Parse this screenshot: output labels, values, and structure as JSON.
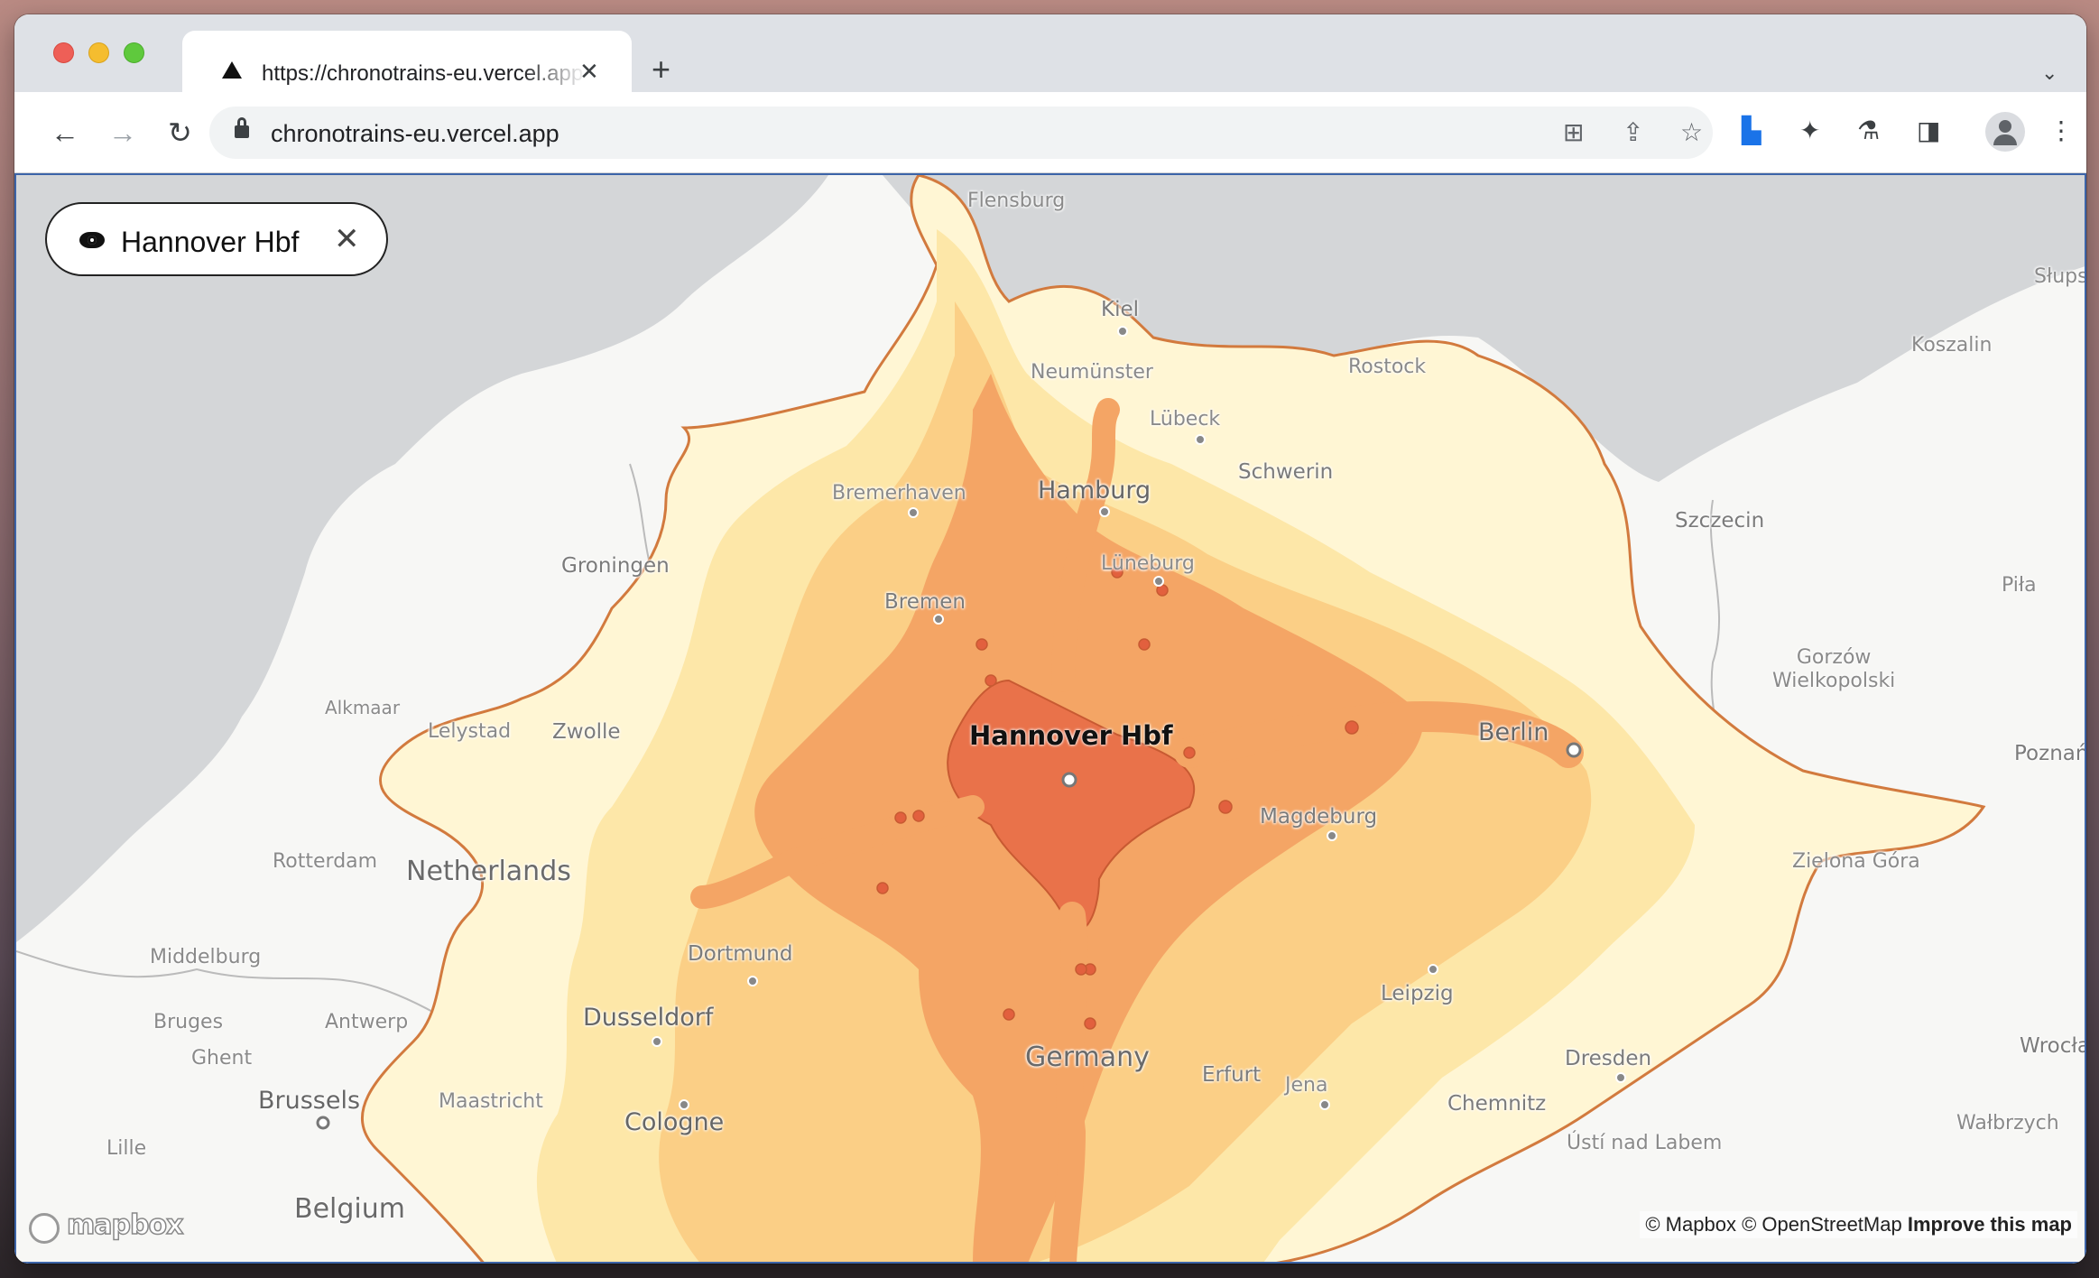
{
  "browser": {
    "tab_title": "https://chronotrains-eu.vercel.app",
    "tab_close": "✕",
    "new_tab": "+",
    "tab_menu": "⌄",
    "url": "chronotrains-eu.vercel.app",
    "icons": [
      "back-icon",
      "forward-icon",
      "reload-icon",
      "lock-icon",
      "translate-icon",
      "share-icon",
      "star-icon",
      "analytics-extension-icon",
      "extensions-icon",
      "labs-icon",
      "side-panel-icon",
      "profile-icon",
      "menu-icon"
    ]
  },
  "search": {
    "station": "Hannover Hbf",
    "close": "✕"
  },
  "map": {
    "labels": {
      "flensburg": "Flensburg",
      "kiel": "Kiel",
      "neumunster": "Neumünster",
      "lubeck": "Lübeck",
      "rostock": "Rostock",
      "hamburg": "Hamburg",
      "schwerin": "Schwerin",
      "bremerhaven": "Bremerhaven",
      "luneburg": "Lüneburg",
      "groningen": "Groningen",
      "bremen": "Bremen",
      "szczecin": "Szczecin",
      "slupsk": "Słups",
      "koszalin": "Koszalin",
      "pila": "Piła",
      "gorzow": "Gorzów\nWielkopolski",
      "alkmaar": "Alkmaar",
      "lelystad": "Lelystad",
      "zwolle": "Zwolle",
      "hannover": "Hannover Hbf",
      "berlin": "Berlin",
      "poznan": "Poznań",
      "rotterdam": "Rotterdam",
      "netherlands": "Netherlands",
      "magdeburg": "Magdeburg",
      "zielona": "Zielona Góra",
      "middelburg": "Middelburg",
      "dortmund": "Dortmund",
      "leipzig": "Leipzig",
      "bruges": "Bruges",
      "antwerp": "Antwerp",
      "dusseldorf": "Dusseldorf",
      "ghent": "Ghent",
      "germany": "Germany",
      "wroclaw": "Wrocła",
      "dresden": "Dresden",
      "erfurt": "Erfurt",
      "brussels": "Brussels",
      "maastricht": "Maastricht",
      "jena": "Jena",
      "chemnitz": "Chemnitz",
      "walbrzych": "Wałbrzych",
      "cologne": "Cologne",
      "lille": "Lille",
      "usti": "Ústí nad Labem",
      "belgium": "Belgium"
    },
    "mapbox_logo": "mapbox",
    "attribution_mapbox": "© Mapbox",
    "attribution_osm": "© OpenStreetMap",
    "attribution_improve": "Improve this map"
  },
  "colors": {
    "sea": "#d4d6d8",
    "land": "#f7f7f5",
    "zone1": "#fff6d4",
    "zone2": "#fde7a8",
    "zone3": "#fbcf86",
    "zone4": "#f4a565",
    "zone5": "#e9724a",
    "outline": "#d27a3e"
  }
}
